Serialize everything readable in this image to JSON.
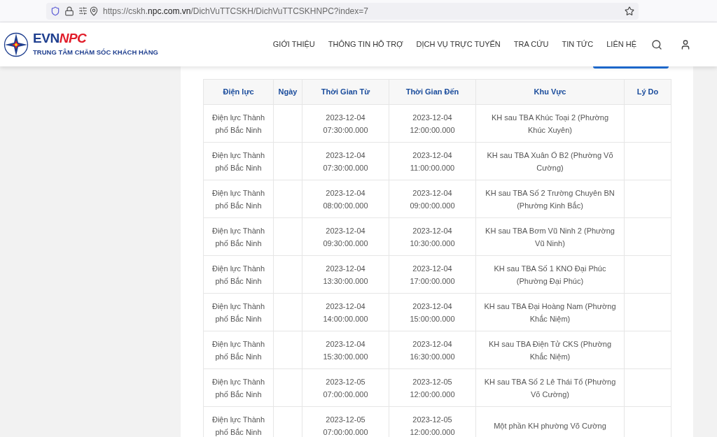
{
  "browser": {
    "url": "https://cskh.**npc.com.vn**/DichVuTTCSKH/DichVuTTCSKHNPC?index=7"
  },
  "header": {
    "logo": {
      "brand_main": "EVN",
      "brand_accent": "NPC",
      "subtitle": "TRUNG TÂM CHĂM SÓC KHÁCH HÀNG"
    },
    "nav": [
      "GIỚI THIỆU",
      "THÔNG TIN HỖ TRỢ",
      "DỊCH VỤ TRỰC TUYẾN",
      "TRA CỨU",
      "TIN TỨC",
      "LIÊN HỆ"
    ]
  },
  "table": {
    "columns": [
      "Điện lực",
      "Ngày",
      "Thời Gian Từ",
      "Thời Gian Đến",
      "Khu Vực",
      "Lý Do"
    ],
    "rows": [
      {
        "dien_luc": "Điện lực Thành phố Bắc Ninh",
        "tu": [
          "2023-12-04",
          "07:30:00.000"
        ],
        "den": [
          "2023-12-04",
          "12:00:00.000"
        ],
        "khu_vuc": "KH sau TBA Khúc Toại 2 (Phường Khúc Xuyên)"
      },
      {
        "dien_luc": "Điện lực Thành phố Bắc Ninh",
        "tu": [
          "2023-12-04",
          "07:30:00.000"
        ],
        "den": [
          "2023-12-04",
          "11:00:00.000"
        ],
        "khu_vuc": "KH sau TBA Xuân Ổ B2 (Phường Võ Cường)"
      },
      {
        "dien_luc": "Điện lực Thành phố Bắc Ninh",
        "tu": [
          "2023-12-04",
          "08:00:00.000"
        ],
        "den": [
          "2023-12-04",
          "09:00:00.000"
        ],
        "khu_vuc": "KH sau TBA Số 2 Trường Chuyên BN (Phường Kinh Bắc)"
      },
      {
        "dien_luc": "Điện lực Thành phố Bắc Ninh",
        "tu": [
          "2023-12-04",
          "09:30:00.000"
        ],
        "den": [
          "2023-12-04",
          "10:30:00.000"
        ],
        "khu_vuc": "KH sau TBA Bơm Vũ Ninh 2 (Phường Vũ Ninh)"
      },
      {
        "dien_luc": "Điện lực Thành phố Bắc Ninh",
        "tu": [
          "2023-12-04",
          "13:30:00.000"
        ],
        "den": [
          "2023-12-04",
          "17:00:00.000"
        ],
        "khu_vuc": "KH sau TBA Số 1 KNO Đại Phúc (Phường Đại Phúc)"
      },
      {
        "dien_luc": "Điện lực Thành phố Bắc Ninh",
        "tu": [
          "2023-12-04",
          "14:00:00.000"
        ],
        "den": [
          "2023-12-04",
          "15:00:00.000"
        ],
        "khu_vuc": "KH sau TBA Đại Hoàng Nam (Phường Khắc Niệm)"
      },
      {
        "dien_luc": "Điện lực Thành phố Bắc Ninh",
        "tu": [
          "2023-12-04",
          "15:30:00.000"
        ],
        "den": [
          "2023-12-04",
          "16:30:00.000"
        ],
        "khu_vuc": "KH sau TBA Điện Tử CKS (Phường Khắc Niệm)"
      },
      {
        "dien_luc": "Điện lực Thành phố Bắc Ninh",
        "tu": [
          "2023-12-05",
          "07:00:00.000"
        ],
        "den": [
          "2023-12-05",
          "12:00:00.000"
        ],
        "khu_vuc": "KH sau TBA Số 2 Lê Thái Tổ (Phường Võ Cường)"
      },
      {
        "dien_luc": "Điện lực Thành phố Bắc Ninh",
        "tu": [
          "2023-12-05",
          "07:00:00.000"
        ],
        "den": [
          "2023-12-05",
          "12:00:00.000"
        ],
        "khu_vuc": "Một phần KH phường Võ Cường"
      }
    ]
  }
}
